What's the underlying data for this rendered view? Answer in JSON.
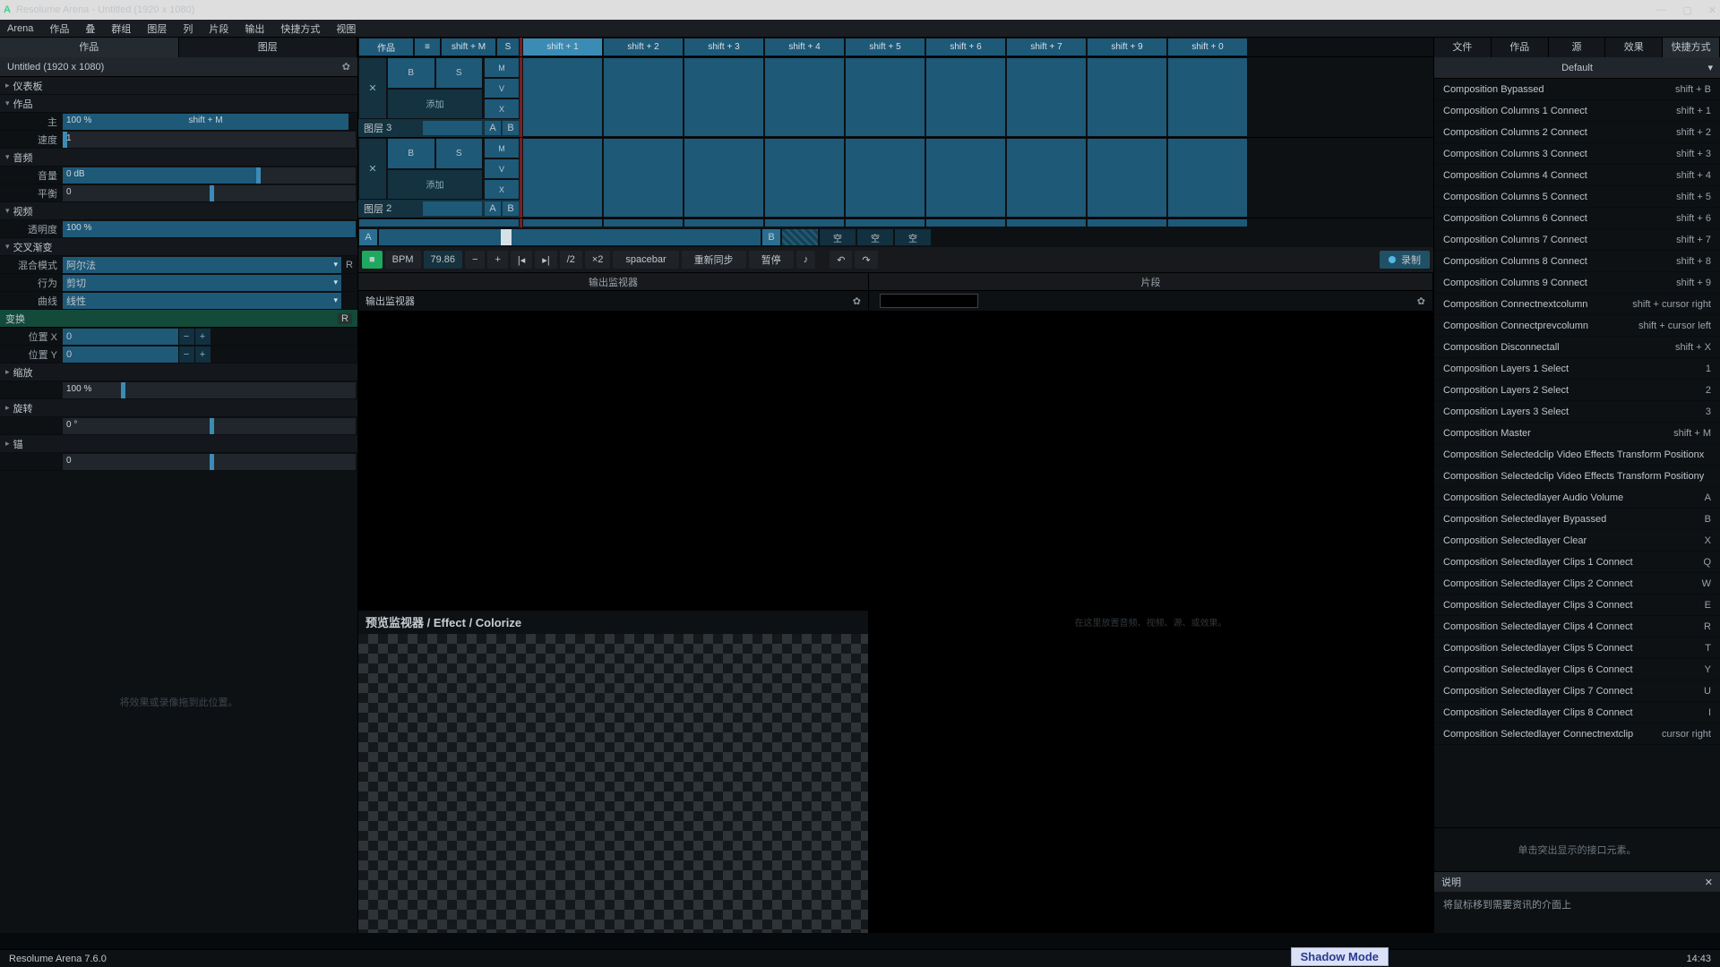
{
  "title": "Resolume Arena - Untitled (1920 x 1080)",
  "menu": [
    "Arena",
    "作品",
    "叠",
    "群组",
    "图层",
    "列",
    "片段",
    "输出",
    "快捷方式",
    "视图"
  ],
  "leftTabs": {
    "a": "作品",
    "b": "图层"
  },
  "composition": "Untitled (1920 x 1080)",
  "sections": {
    "dashboard": "仪表板",
    "composition_h": "作品",
    "audio": "音频",
    "video": "视频",
    "crossfade": "交叉渐变",
    "transform": "变换",
    "scale": "缩放",
    "rotate": "旋转",
    "anchor": "锚"
  },
  "params": {
    "master": {
      "label": "主",
      "value": "100 %",
      "hotkey": "shift + M"
    },
    "speed": {
      "label": "速度",
      "value": "1"
    },
    "volume": {
      "label": "音量",
      "value": "0 dB"
    },
    "pan": {
      "label": "平衡",
      "value": "0"
    },
    "opacity": {
      "label": "透明度",
      "value": "100 %"
    },
    "blend": {
      "label": "混合模式",
      "value": "阿尔法"
    },
    "behavior": {
      "label": "行为",
      "value": "剪切"
    },
    "curve": {
      "label": "曲线",
      "value": "线性"
    },
    "posx": {
      "label": "位置 X",
      "value": "0"
    },
    "posy": {
      "label": "位置 Y",
      "value": "0"
    },
    "scale": {
      "label": "",
      "value": "100 %"
    },
    "rotate": {
      "label": "",
      "value": "0 °"
    },
    "anchor": {
      "label": "",
      "value": "0"
    }
  },
  "emptyHint": "将效果或录像拖到此位置。",
  "columnHeaders": {
    "blockA": "作品",
    "blockB": "shift + M",
    "blockS": "S",
    "cols": [
      "shift + 1",
      "shift + 2",
      "shift + 3",
      "shift + 4",
      "shift + 5",
      "shift + 6",
      "shift + 7",
      "shift + 9",
      "shift + 0"
    ]
  },
  "layer": {
    "x": "✕",
    "b": "B",
    "s": "S",
    "m": "M",
    "add": "添加",
    "labelPrefix": "图层",
    "num3": "3",
    "num2": "2",
    "a": "A",
    "bb": "B",
    "v": "V",
    "x2": "X"
  },
  "crossfader": {
    "a": "A",
    "b": "B",
    "empty": "空"
  },
  "transport": {
    "bpmLabel": "BPM",
    "bpmValue": "79.86",
    "minus": "−",
    "plus": "+",
    "back": "|◂",
    "fwd": "▸|",
    "half": "/2",
    "double": "×2",
    "spacebar": "spacebar",
    "resync": "重新同步",
    "pause": "暂停",
    "metro": "♪",
    "undo": "↶",
    "redo": "↷",
    "record": "录制"
  },
  "monitors": {
    "outHeader": "输出监视器",
    "outSub": "输出监视器",
    "clipHeader": "片段",
    "clipEmpty": "在这里放置音频、视频、源、或效果。"
  },
  "preview": "预览监视器 / Effect / Colorize",
  "rightTabs": [
    "文件",
    "作品",
    "源",
    "效果",
    "快捷方式"
  ],
  "preset": "Default",
  "shortcuts": [
    {
      "n": "Composition Bypassed",
      "k": "shift + B"
    },
    {
      "n": "Composition Columns 1 Connect",
      "k": "shift + 1"
    },
    {
      "n": "Composition Columns 2 Connect",
      "k": "shift + 2"
    },
    {
      "n": "Composition Columns 3 Connect",
      "k": "shift + 3"
    },
    {
      "n": "Composition Columns 4 Connect",
      "k": "shift + 4"
    },
    {
      "n": "Composition Columns 5 Connect",
      "k": "shift + 5"
    },
    {
      "n": "Composition Columns 6 Connect",
      "k": "shift + 6"
    },
    {
      "n": "Composition Columns 7 Connect",
      "k": "shift + 7"
    },
    {
      "n": "Composition Columns 8 Connect",
      "k": "shift + 8"
    },
    {
      "n": "Composition Columns 9 Connect",
      "k": "shift + 9"
    },
    {
      "n": "Composition Connectnextcolumn",
      "k": "shift + cursor right"
    },
    {
      "n": "Composition Connectprevcolumn",
      "k": "shift + cursor left"
    },
    {
      "n": "Composition Disconnectall",
      "k": "shift + X"
    },
    {
      "n": "Composition Layers 1 Select",
      "k": "1"
    },
    {
      "n": "Composition Layers 2 Select",
      "k": "2"
    },
    {
      "n": "Composition Layers 3 Select",
      "k": "3"
    },
    {
      "n": "Composition Master",
      "k": "shift + M"
    },
    {
      "n": "Composition Selectedclip Video Effects Transform Positionx",
      "k": "",
      "dim": true
    },
    {
      "n": "Composition Selectedclip Video Effects Transform Positiony",
      "k": "",
      "dim": true
    },
    {
      "n": "Composition Selectedlayer Audio Volume",
      "k": "A"
    },
    {
      "n": "Composition Selectedlayer Bypassed",
      "k": "B"
    },
    {
      "n": "Composition Selectedlayer Clear",
      "k": "X"
    },
    {
      "n": "Composition Selectedlayer Clips 1 Connect",
      "k": "Q"
    },
    {
      "n": "Composition Selectedlayer Clips 2 Connect",
      "k": "W"
    },
    {
      "n": "Composition Selectedlayer Clips 3 Connect",
      "k": "E"
    },
    {
      "n": "Composition Selectedlayer Clips 4 Connect",
      "k": "R"
    },
    {
      "n": "Composition Selectedlayer Clips 5 Connect",
      "k": "T"
    },
    {
      "n": "Composition Selectedlayer Clips 6 Connect",
      "k": "Y"
    },
    {
      "n": "Composition Selectedlayer Clips 7 Connect",
      "k": "U"
    },
    {
      "n": "Composition Selectedlayer Clips 8 Connect",
      "k": "I"
    },
    {
      "n": "Composition Selectedlayer Connectnextclip",
      "k": "cursor right"
    }
  ],
  "rpHint": "单击突出显示的接口元素。",
  "descHeader": "说明",
  "descBody": "将鼠标移到需要资讯的介面上",
  "status": {
    "version": "Resolume Arena 7.6.0",
    "time": "14:43"
  },
  "shadowMode": "Shadow Mode",
  "r": "R"
}
